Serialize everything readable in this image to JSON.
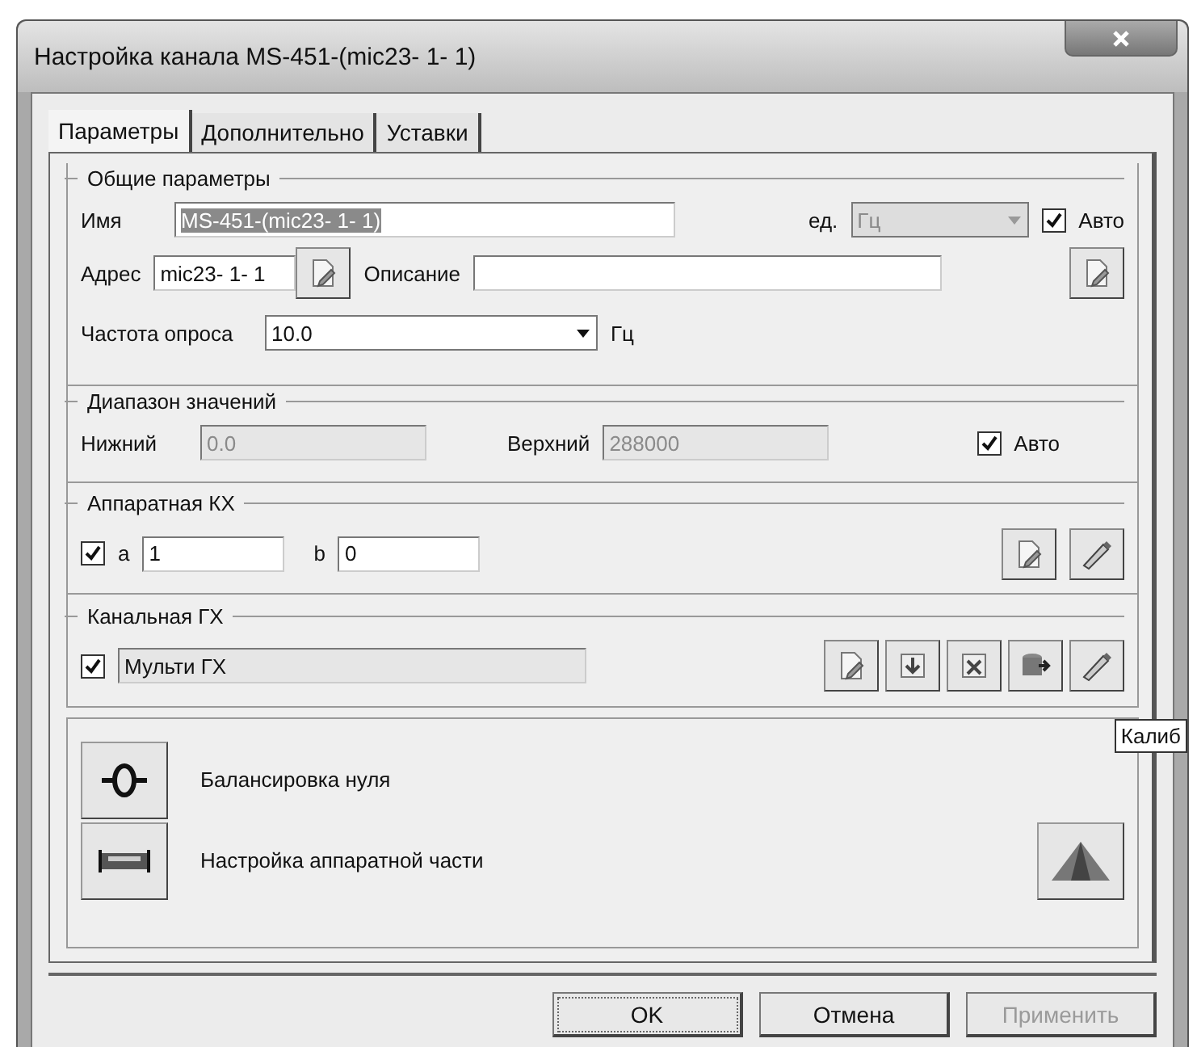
{
  "window": {
    "title": "Настройка канала MS-451-(mic23- 1- 1)"
  },
  "tabs": [
    {
      "label": "Параметры",
      "selected": true
    },
    {
      "label": "Дополнительно",
      "selected": false
    },
    {
      "label": "Уставки",
      "selected": false
    }
  ],
  "general": {
    "title": "Общие параметры",
    "name_label": "Имя",
    "name_value": "MS-451-(mic23- 1- 1)",
    "name_highlighted": true,
    "unit_label": "ед.",
    "unit_value": "Гц",
    "unit_disabled": true,
    "auto": {
      "label": "Авто",
      "checked": true
    },
    "address_label": "Адрес",
    "address_value": "mic23- 1- 1",
    "description_label": "Описание",
    "frequency_label": "Частота опроса",
    "frequency_value": "10.0",
    "frequency_unit": "Гц"
  },
  "range": {
    "title": "Диапазон значений",
    "lower_label": "Нижний",
    "lower_value": "0.0",
    "upper_label": "Верхний",
    "upper_value": "288000",
    "disabled": true,
    "auto": {
      "label": "Авто",
      "checked": true
    }
  },
  "hardware": {
    "title": "Аппаратная КХ",
    "checked": true,
    "a_label": "а",
    "a_value": "1",
    "b_label": "b",
    "b_value": "0"
  },
  "channel": {
    "title": "Канальная ГХ",
    "checked": true,
    "value": "Мульти ГХ"
  },
  "actions": [
    {
      "kind": "balance",
      "label": "Балансировка нуля"
    },
    {
      "kind": "hardware",
      "label": "Настройка аппаратной части"
    }
  ],
  "tooltip": "Калиб",
  "buttons": [
    {
      "label": "OK",
      "disabled": false,
      "default": true
    },
    {
      "label": "Отмена",
      "disabled": false,
      "default": false
    },
    {
      "label": "Применить",
      "disabled": true,
      "default": false
    }
  ]
}
